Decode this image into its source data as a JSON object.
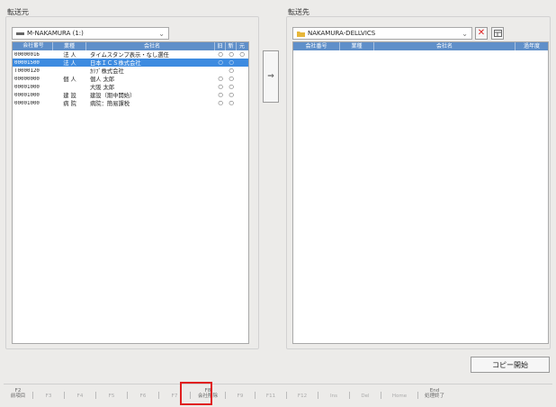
{
  "source": {
    "label": "転送元",
    "combo_value": "M-NAKAMURA (1:)",
    "columns": [
      "会社番号",
      "業種",
      "会社名",
      "旧",
      "新",
      "元"
    ],
    "rows": [
      {
        "code": "00000016",
        "type": "法 人",
        "name": "タイムスタンプ表示・なし選任",
        "f1": "○",
        "f2": "○",
        "f3": "○",
        "selected": false
      },
      {
        "code": "00001500",
        "type": "法 人",
        "name": "日本ＩＣＳ株式会社",
        "f1": "○",
        "f2": "○",
        "f3": "",
        "selected": true
      },
      {
        "code": "T0000120",
        "type": "",
        "name": "ｶﾘﾌﾞ株式会社",
        "f1": "",
        "f2": "○",
        "f3": "",
        "selected": false
      },
      {
        "code": "00000000",
        "type": "個 人",
        "name": "個人 太郎",
        "f1": "○",
        "f2": "○",
        "f3": "",
        "selected": false
      },
      {
        "code": "00001000",
        "type": "",
        "name": "大阪 太郎",
        "f1": "○",
        "f2": "○",
        "f3": "",
        "selected": false
      },
      {
        "code": "00001000",
        "type": "建 設",
        "name": "建設（期中開始）",
        "f1": "○",
        "f2": "○",
        "f3": "",
        "selected": false
      },
      {
        "code": "00001000",
        "type": "病 院",
        "name": "病院：簡易課税",
        "f1": "○",
        "f2": "○",
        "f3": "",
        "selected": false
      }
    ]
  },
  "transfer_button": "⇒",
  "target": {
    "label": "転送先",
    "combo_value": "NAKAMURA-DELLVICS",
    "columns": [
      "会社番号",
      "業種",
      "会社名",
      "過年度"
    ]
  },
  "copy_button": "コピー開始",
  "fkeys": [
    {
      "key": "F2",
      "label": "前項目",
      "dim": false
    },
    {
      "key": "F3",
      "label": "",
      "dim": true
    },
    {
      "key": "F4",
      "label": "",
      "dim": true
    },
    {
      "key": "F5",
      "label": "",
      "dim": true
    },
    {
      "key": "F6",
      "label": "",
      "dim": true
    },
    {
      "key": "F7",
      "label": "",
      "dim": true
    },
    {
      "key": "F8",
      "label": "会社削除",
      "dim": false
    },
    {
      "key": "F9",
      "label": "",
      "dim": true
    },
    {
      "key": "F11",
      "label": "",
      "dim": true
    },
    {
      "key": "F12",
      "label": "",
      "dim": true
    },
    {
      "key": "Ins",
      "label": "",
      "dim": true
    },
    {
      "key": "Del",
      "label": "",
      "dim": true
    },
    {
      "key": "Home",
      "label": "",
      "dim": true
    },
    {
      "key": "End",
      "label": "処理終了",
      "dim": false
    }
  ],
  "highlight_color": "#e02020"
}
